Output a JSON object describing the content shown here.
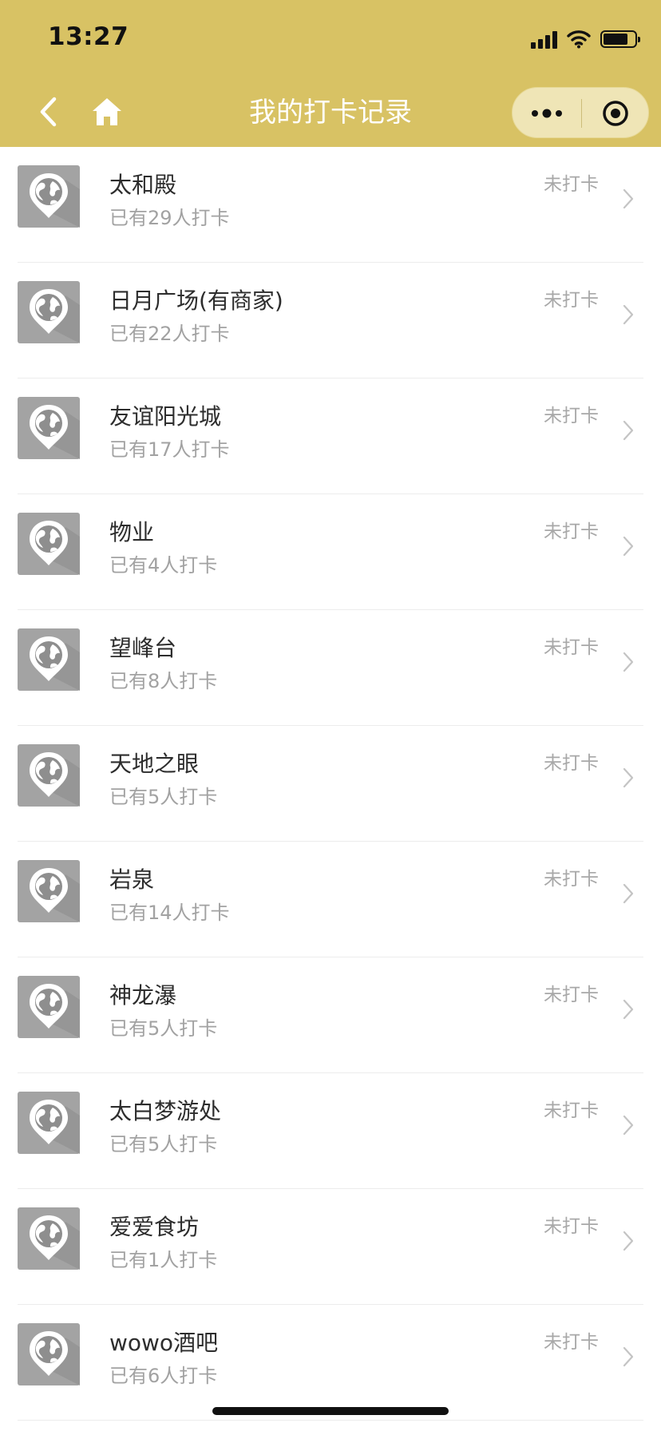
{
  "status_bar": {
    "time": "13:27",
    "signal_icon": "cellular-signal-icon",
    "wifi_icon": "wifi-icon",
    "battery_icon": "battery-icon",
    "battery_level": 0.8
  },
  "header": {
    "title": "我的打卡记录",
    "back_icon": "chevron-left-icon",
    "home_icon": "home-icon",
    "more_icon": "more-dots-icon",
    "close_icon": "target-circle-icon",
    "background_color": "#d8c264"
  },
  "list": {
    "items": [
      {
        "name": "太和殿",
        "count_text": "已有29人打卡",
        "status": "未打卡"
      },
      {
        "name": "日月广场(有商家)",
        "count_text": "已有22人打卡",
        "status": "未打卡"
      },
      {
        "name": "友谊阳光城",
        "count_text": "已有17人打卡",
        "status": "未打卡"
      },
      {
        "name": "物业",
        "count_text": "已有4人打卡",
        "status": "未打卡"
      },
      {
        "name": "望峰台",
        "count_text": "已有8人打卡",
        "status": "未打卡"
      },
      {
        "name": "天地之眼",
        "count_text": "已有5人打卡",
        "status": "未打卡"
      },
      {
        "name": "岩泉",
        "count_text": "已有14人打卡",
        "status": "未打卡"
      },
      {
        "name": "神龙瀑",
        "count_text": "已有5人打卡",
        "status": "未打卡"
      },
      {
        "name": "太白梦游处",
        "count_text": "已有5人打卡",
        "status": "未打卡"
      },
      {
        "name": "爱爱食坊",
        "count_text": "已有1人打卡",
        "status": "未打卡"
      },
      {
        "name": "wowo酒吧",
        "count_text": "已有6人打卡",
        "status": "未打卡"
      }
    ],
    "item_icon": "globe-location-pin-icon",
    "item_chevron_icon": "chevron-right-icon"
  }
}
